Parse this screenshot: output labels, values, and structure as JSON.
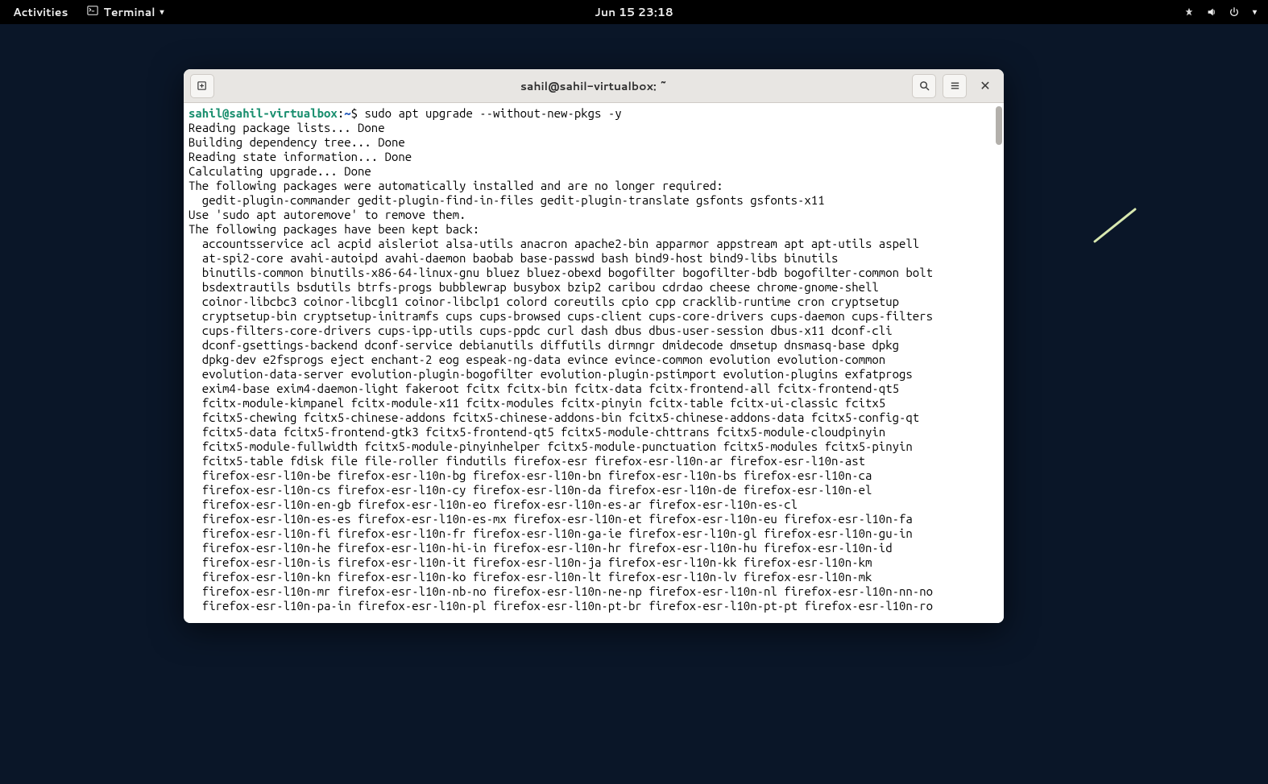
{
  "topbar": {
    "activities": "Activities",
    "app_name": "Terminal",
    "datetime": "Jun 15  23:18"
  },
  "window": {
    "title": "sahil@sahil-virtualbox: ~"
  },
  "prompt": {
    "user_host": "sahil@sahil-virtualbox",
    "sep": ":",
    "path": "~",
    "symbol": "$",
    "command": "sudo apt upgrade --without-new-pkgs -y"
  },
  "output": {
    "l1": "Reading package lists... Done",
    "l2": "Building dependency tree... Done",
    "l3": "Reading state information... Done",
    "l4": "Calculating upgrade... Done",
    "l5": "The following packages were automatically installed and are no longer required:",
    "l6": "gedit-plugin-commander gedit-plugin-find-in-files gedit-plugin-translate gsfonts gsfonts-x11",
    "l7": "Use 'sudo apt autoremove' to remove them.",
    "l8": "The following packages have been kept back:",
    "kb1": "accountsservice acl acpid aisleriot alsa-utils anacron apache2-bin apparmor appstream apt apt-utils aspell",
    "kb2": "at-spi2-core avahi-autoipd avahi-daemon baobab base-passwd bash bind9-host bind9-libs binutils",
    "kb3": "binutils-common binutils-x86-64-linux-gnu bluez bluez-obexd bogofilter bogofilter-bdb bogofilter-common bolt",
    "kb4": "bsdextrautils bsdutils btrfs-progs bubblewrap busybox bzip2 caribou cdrdao cheese chrome-gnome-shell",
    "kb5": "coinor-libcbc3 coinor-libcgl1 coinor-libclp1 colord coreutils cpio cpp cracklib-runtime cron cryptsetup",
    "kb6": "cryptsetup-bin cryptsetup-initramfs cups cups-browsed cups-client cups-core-drivers cups-daemon cups-filters",
    "kb7": "cups-filters-core-drivers cups-ipp-utils cups-ppdc curl dash dbus dbus-user-session dbus-x11 dconf-cli",
    "kb8": "dconf-gsettings-backend dconf-service debianutils diffutils dirmngr dmidecode dmsetup dnsmasq-base dpkg",
    "kb9": "dpkg-dev e2fsprogs eject enchant-2 eog espeak-ng-data evince evince-common evolution evolution-common",
    "kb10": "evolution-data-server evolution-plugin-bogofilter evolution-plugin-pstimport evolution-plugins exfatprogs",
    "kb11": "exim4-base exim4-daemon-light fakeroot fcitx fcitx-bin fcitx-data fcitx-frontend-all fcitx-frontend-qt5",
    "kb12": "fcitx-module-kimpanel fcitx-module-x11 fcitx-modules fcitx-pinyin fcitx-table fcitx-ui-classic fcitx5",
    "kb13": "fcitx5-chewing fcitx5-chinese-addons fcitx5-chinese-addons-bin fcitx5-chinese-addons-data fcitx5-config-qt",
    "kb14": "fcitx5-data fcitx5-frontend-gtk3 fcitx5-frontend-qt5 fcitx5-module-chttrans fcitx5-module-cloudpinyin",
    "kb15": "fcitx5-module-fullwidth fcitx5-module-pinyinhelper fcitx5-module-punctuation fcitx5-modules fcitx5-pinyin",
    "kb16": "fcitx5-table fdisk file file-roller findutils firefox-esr firefox-esr-l10n-ar firefox-esr-l10n-ast",
    "kb17": "firefox-esr-l10n-be firefox-esr-l10n-bg firefox-esr-l10n-bn firefox-esr-l10n-bs firefox-esr-l10n-ca",
    "kb18": "firefox-esr-l10n-cs firefox-esr-l10n-cy firefox-esr-l10n-da firefox-esr-l10n-de firefox-esr-l10n-el",
    "kb19": "firefox-esr-l10n-en-gb firefox-esr-l10n-eo firefox-esr-l10n-es-ar firefox-esr-l10n-es-cl",
    "kb20": "firefox-esr-l10n-es-es firefox-esr-l10n-es-mx firefox-esr-l10n-et firefox-esr-l10n-eu firefox-esr-l10n-fa",
    "kb21": "firefox-esr-l10n-fi firefox-esr-l10n-fr firefox-esr-l10n-ga-ie firefox-esr-l10n-gl firefox-esr-l10n-gu-in",
    "kb22": "firefox-esr-l10n-he firefox-esr-l10n-hi-in firefox-esr-l10n-hr firefox-esr-l10n-hu firefox-esr-l10n-id",
    "kb23": "firefox-esr-l10n-is firefox-esr-l10n-it firefox-esr-l10n-ja firefox-esr-l10n-kk firefox-esr-l10n-km",
    "kb24": "firefox-esr-l10n-kn firefox-esr-l10n-ko firefox-esr-l10n-lt firefox-esr-l10n-lv firefox-esr-l10n-mk",
    "kb25": "firefox-esr-l10n-mr firefox-esr-l10n-nb-no firefox-esr-l10n-ne-np firefox-esr-l10n-nl firefox-esr-l10n-nn-no",
    "kb26": "firefox-esr-l10n-pa-in firefox-esr-l10n-pl firefox-esr-l10n-pt-br firefox-esr-l10n-pt-pt firefox-esr-l10n-ro"
  }
}
